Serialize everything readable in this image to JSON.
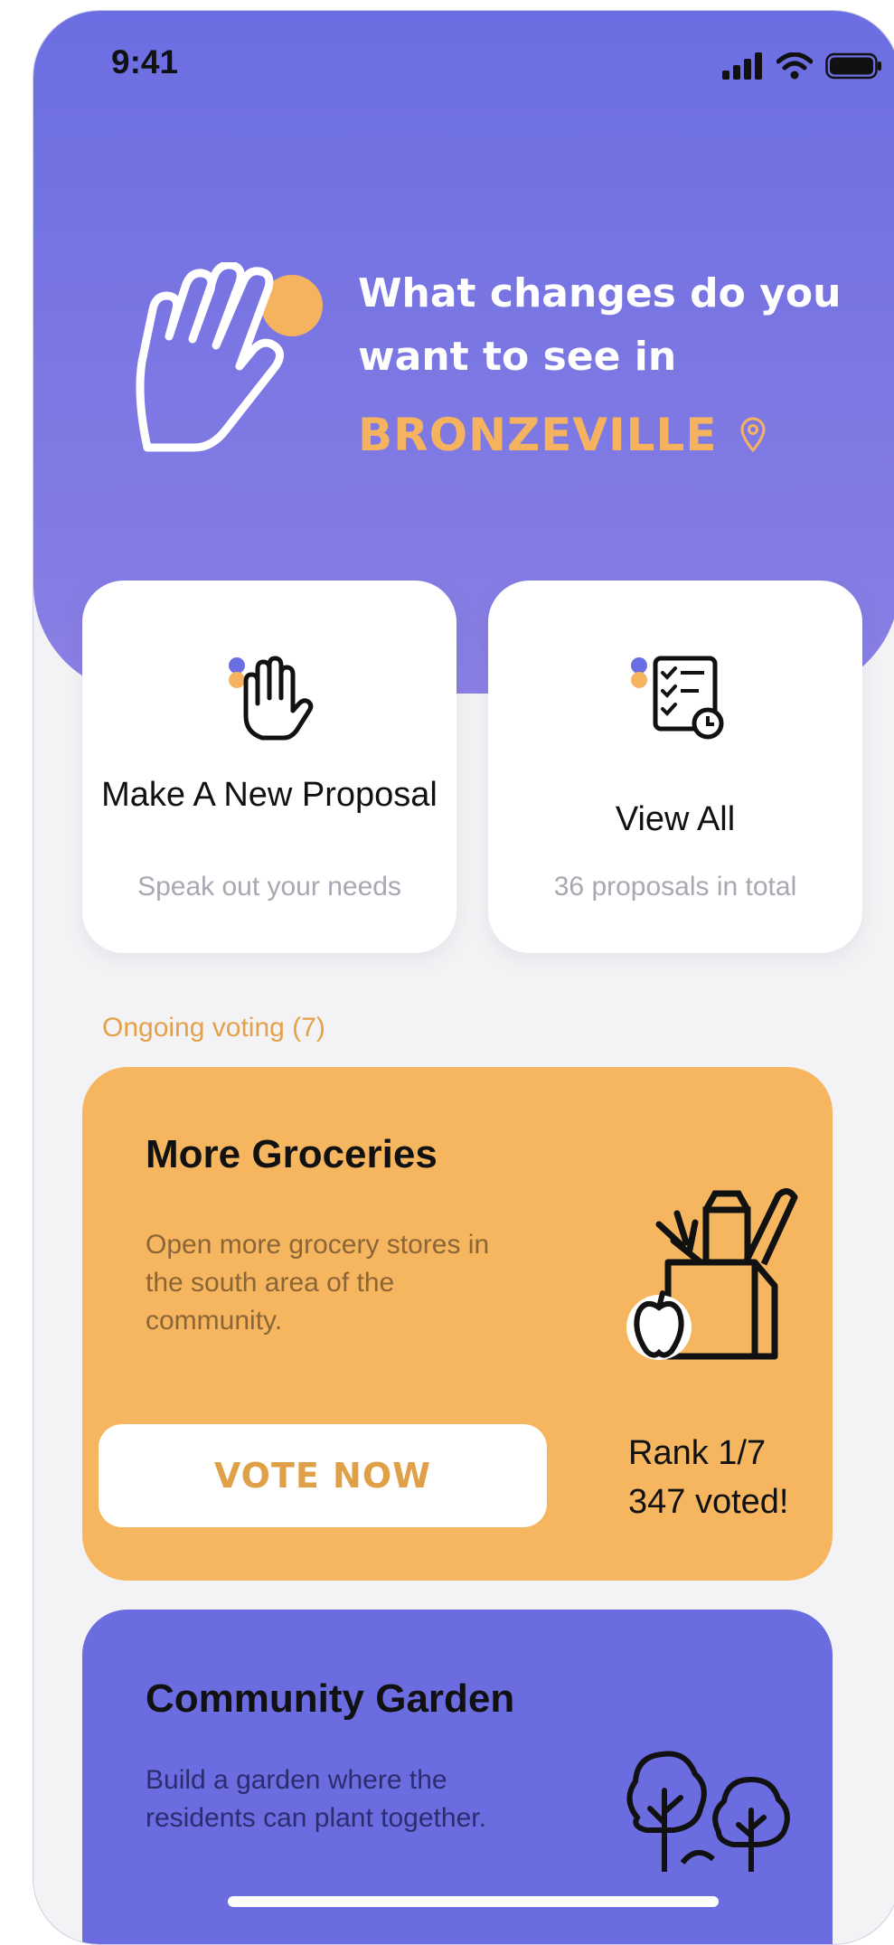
{
  "status_bar": {
    "time": "9:41",
    "icons": [
      "signal-icon",
      "wifi-icon",
      "battery-icon"
    ]
  },
  "hero": {
    "question": "What changes do you want to see in",
    "location": "BRONZEVILLE",
    "icons": [
      "raised-hand-icon",
      "location-pin-icon"
    ]
  },
  "actions": [
    {
      "title": "Make A New Proposal",
      "subtitle": "Speak out your needs",
      "icon": "hand-icon"
    },
    {
      "title": "View All",
      "subtitle": "36 proposals in total",
      "icon": "checklist-icon"
    }
  ],
  "ongoing_label": "Ongoing voting (7)",
  "proposals": [
    {
      "title": "More Groceries",
      "description": "Open more grocery stores in the south area of the community.",
      "button_label": "VOTE NOW",
      "rank": "Rank 1/7",
      "votes": "347 voted!",
      "icon": "grocery-bag-icon"
    },
    {
      "title": "Community Garden",
      "description": "Build a garden where the residents can plant together.",
      "icon": "trees-icon"
    }
  ],
  "colors": {
    "primary_purple": "#6b6ee2",
    "accent_orange": "#f5b35f",
    "card_purple": "#6a6ce0",
    "background": "#f3f3f5"
  }
}
